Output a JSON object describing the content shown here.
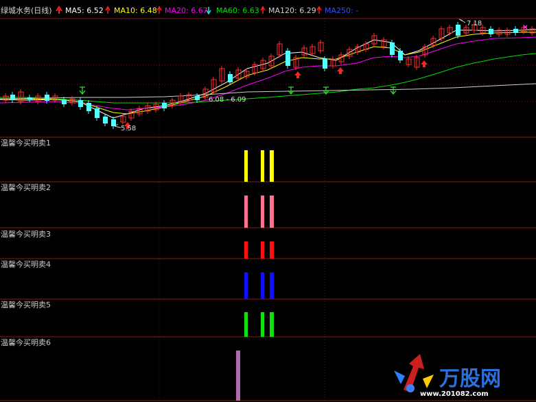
{
  "colors": {
    "background": "#000000",
    "panel_border": "#8b1a1a",
    "grid_dots": "#7a1a1a",
    "up_candle": "#ff3030",
    "down_candle": "#54ffff",
    "ma5": "#ffffff",
    "ma10": "#ffff00",
    "ma20": "#ff00ff",
    "ma60": "#00e000",
    "ma120": "#d0d0d0",
    "ma250": "#2040ff",
    "signal_1": "#ffff00",
    "signal_2": "#ff7090",
    "signal_3": "#ff1010",
    "signal_4": "#1010ff",
    "signal_5": "#10e010",
    "signal_6": "#b06ab0"
  },
  "header": {
    "title": "绿城水务(日线)",
    "ma5_label": "MA5: 6.52",
    "ma10_label": "MA10: 6.48",
    "ma20_label": "MA20: 6.67",
    "ma60_label": "MA60: 6.63",
    "ma120_label": "MA120: 6.29",
    "ma250_label": "MA250: -",
    "ma5_arrow": "up-arrow-icon",
    "ma10_arrow": "up-arrow-icon",
    "ma20_arrow": "down-arrow-icon",
    "ma60_arrow": "up-arrow-icon",
    "ma120_arrow": "up-arrow-icon"
  },
  "annotations": {
    "high_label": "7.18",
    "low_label": "5.58",
    "mid_label": "6.08 - 6.09"
  },
  "indicator_panels": [
    {
      "label": "温馨今买明卖1"
    },
    {
      "label": "温馨今买明卖2"
    },
    {
      "label": "温馨今买明卖3"
    },
    {
      "label": "温馨今买明卖4"
    },
    {
      "label": "温馨今买明卖5"
    },
    {
      "label": "温馨今买明卖6"
    }
  ],
  "watermark": {
    "brand": "万股网",
    "url": "www.201082.com"
  }
}
